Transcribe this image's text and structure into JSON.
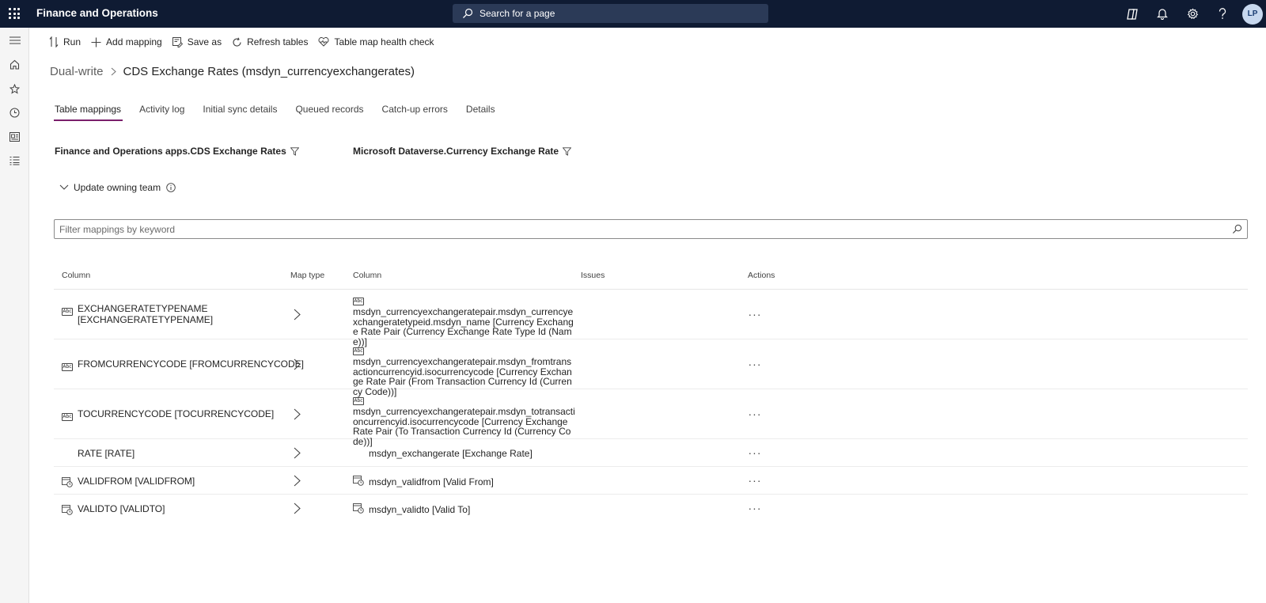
{
  "app": {
    "title": "Finance and Operations"
  },
  "search": {
    "placeholder": "Search for a page"
  },
  "user": {
    "initials": "LP"
  },
  "commands": {
    "run": "Run",
    "add_mapping": "Add mapping",
    "save_as": "Save as",
    "refresh_tables": "Refresh tables",
    "health_check": "Table map health check"
  },
  "breadcrumb": {
    "parent": "Dual-write",
    "current": "CDS Exchange Rates (msdyn_currencyexchangerates)"
  },
  "tabs": [
    "Table mappings",
    "Activity log",
    "Initial sync details",
    "Queued records",
    "Catch-up errors",
    "Details"
  ],
  "entities": {
    "source": "Finance and Operations apps.CDS Exchange Rates",
    "target": "Microsoft Dataverse.Currency Exchange Rate"
  },
  "owning_team": {
    "label": "Update owning team"
  },
  "filter": {
    "placeholder": "Filter mappings by keyword"
  },
  "table": {
    "headers": {
      "column_src": "Column",
      "map_type": "Map type",
      "column_dst": "Column",
      "issues": "Issues",
      "actions": "Actions"
    },
    "rows": [
      {
        "source": "EXCHANGERATETYPENAME [EXCHANGERATETYPENAME]",
        "source_icon": "text-field-icon",
        "target": "msdyn_currencyexchangeratepair.msdyn_currencyexchangeratetypeid.msdyn_name [Currency Exchange Rate Pair (Currency Exchange Rate Type Id (Name))]",
        "target_icon": "text-field-icon",
        "actions": "···"
      },
      {
        "source": "FROMCURRENCYCODE [FROMCURRENCYCODE]",
        "source_icon": "text-field-icon",
        "target": "msdyn_currencyexchangeratepair.msdyn_fromtransactioncurrencyid.isocurrencycode [Currency Exchange Rate Pair (From Transaction Currency Id (Currency Code))]",
        "target_icon": "text-field-icon",
        "actions": "···"
      },
      {
        "source": "TOCURRENCYCODE [TOCURRENCYCODE]",
        "source_icon": "text-field-icon",
        "target": "msdyn_currencyexchangeratepair.msdyn_totransactioncurrencyid.isocurrencycode [Currency Exchange Rate Pair (To Transaction Currency Id (Currency Code))]",
        "target_icon": "text-field-icon",
        "actions": "···"
      },
      {
        "source": "RATE [RATE]",
        "target": "msdyn_exchangerate [Exchange Rate]",
        "actions": "···"
      },
      {
        "source": "VALIDFROM [VALIDFROM]",
        "source_icon": "datetime-field-icon",
        "target": "msdyn_validfrom [Valid From]",
        "target_icon": "datetime-field-icon",
        "actions": "···"
      },
      {
        "source": "VALIDTO [VALIDTO]",
        "source_icon": "datetime-field-icon",
        "target": "msdyn_validto [Valid To]",
        "target_icon": "datetime-field-icon",
        "actions": "···"
      }
    ]
  },
  "colors": {
    "topbar": "#0f1b33",
    "tab_accent": "#7a1f6b"
  }
}
